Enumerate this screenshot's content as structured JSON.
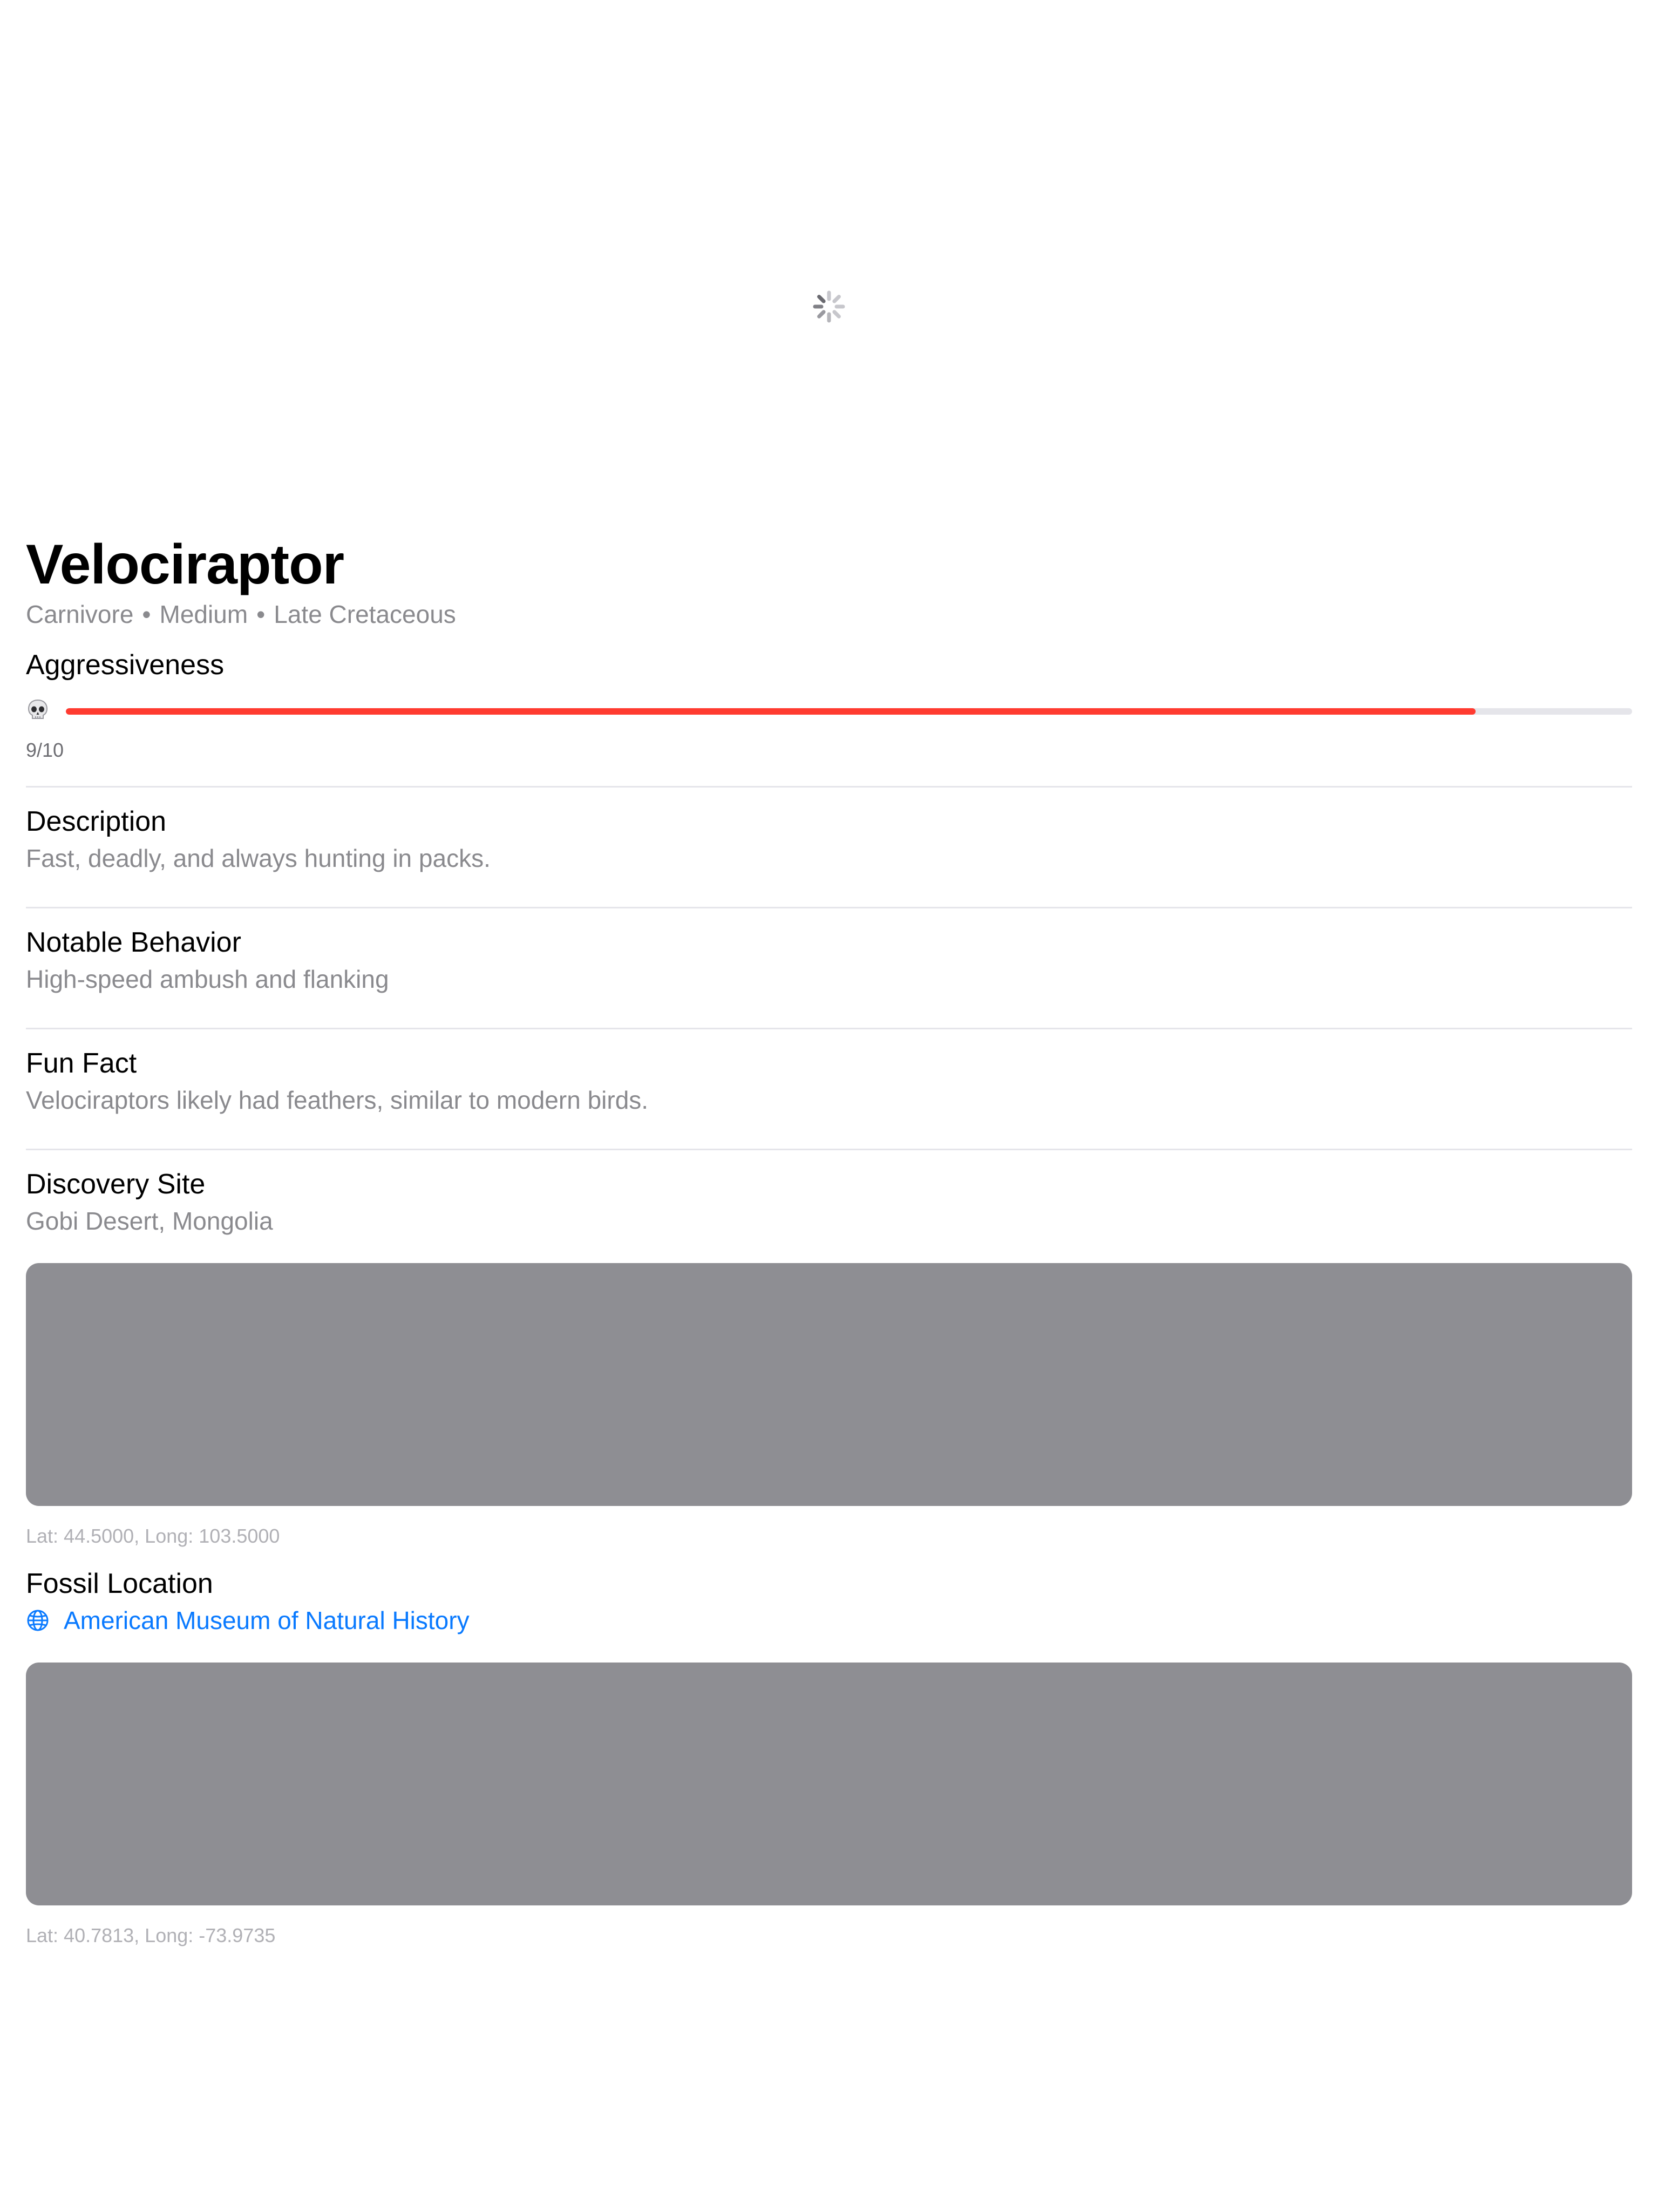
{
  "dino": {
    "name": "Velociraptor",
    "tags": [
      "Carnivore",
      "Medium",
      "Late Cretaceous"
    ],
    "tag_separator": "•"
  },
  "aggressiveness": {
    "label": "Aggressiveness",
    "score_text": "9/10",
    "level": 0.9,
    "icon": "skull-icon",
    "bar_color": "#ff3b30"
  },
  "sections": {
    "description": {
      "title": "Description",
      "text": "Fast, deadly, and always hunting in packs."
    },
    "behavior": {
      "title": "Notable Behavior",
      "text": "High-speed ambush and flanking"
    },
    "fun_fact": {
      "title": "Fun Fact",
      "text": "Velociraptors likely had feathers, similar to modern birds."
    }
  },
  "discovery": {
    "title": "Discovery Site",
    "place": "Gobi Desert, Mongolia",
    "coords": "Lat: 44.5000, Long: 103.5000"
  },
  "fossil": {
    "title": "Fossil Location",
    "museum": "American Museum of Natural History",
    "icon": "globe-icon",
    "link_color": "#0a7aff",
    "coords": "Lat: 40.7813, Long: -73.9735"
  },
  "image": {
    "state": "loading",
    "icon": "loading-spinner-icon"
  }
}
